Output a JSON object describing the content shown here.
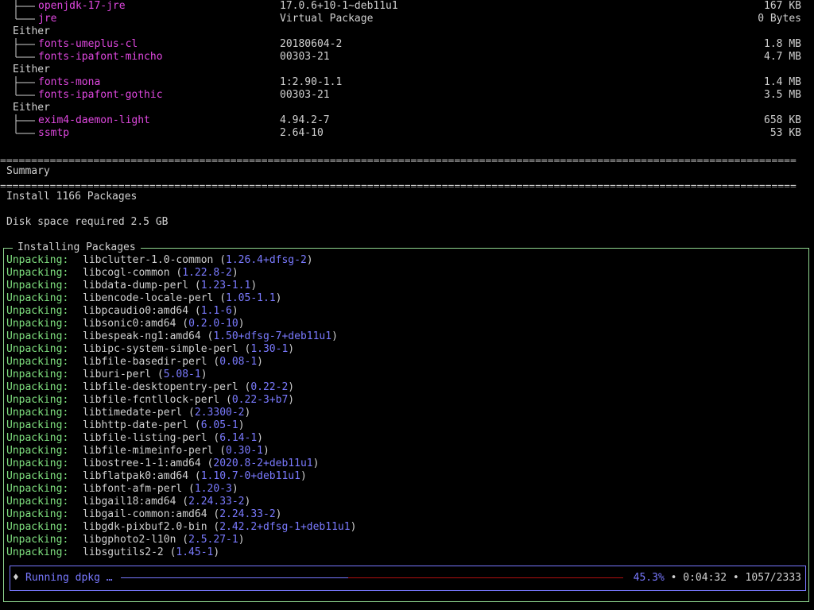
{
  "colors": {
    "background": "#000000",
    "text": "#d0d0d0",
    "package": "#e048e0",
    "status_green": "#7fe07f",
    "version_blue": "#7a7aff",
    "progress_blue": "#7878ff",
    "progress_red": "#b01010",
    "box_border": "#8fd68f"
  },
  "dependencies": {
    "top_items": [
      {
        "name": "openjdk-17-jre",
        "version": "17.0.6+10-1~deb11u1",
        "size": "167 KB"
      },
      {
        "name": "jre",
        "version": "Virtual Package",
        "size": "0 Bytes"
      }
    ],
    "groups": [
      {
        "label": "Either",
        "items": [
          {
            "name": "fonts-umeplus-cl",
            "version": "20180604-2",
            "size": "1.8 MB"
          },
          {
            "name": "fonts-ipafont-mincho",
            "version": "00303-21",
            "size": "4.7 MB"
          }
        ]
      },
      {
        "label": "Either",
        "items": [
          {
            "name": "fonts-mona",
            "version": "1:2.90-1.1",
            "size": "1.4 MB"
          },
          {
            "name": "fonts-ipafont-gothic",
            "version": "00303-21",
            "size": "3.5 MB"
          }
        ]
      },
      {
        "label": "Either",
        "items": [
          {
            "name": "exim4-daemon-light",
            "version": "4.94.2-7",
            "size": "658 KB"
          },
          {
            "name": "ssmtp",
            "version": "2.64-10",
            "size": "53 KB"
          }
        ]
      }
    ]
  },
  "summary": {
    "separator": "================================================================================================================================",
    "title": "Summary",
    "install_count": "Install 1166 Packages",
    "disk_space": "Disk space required  2.5 GB"
  },
  "installing": {
    "title": "Installing Packages",
    "status_label": "Unpacking:",
    "log": [
      {
        "package": "libclutter-1.0-common",
        "version": "1.26.4+dfsg-2"
      },
      {
        "package": "libcogl-common",
        "version": "1.22.8-2"
      },
      {
        "package": "libdata-dump-perl",
        "version": "1.23-1.1"
      },
      {
        "package": "libencode-locale-perl",
        "version": "1.05-1.1"
      },
      {
        "package": "libpcaudio0:amd64",
        "version": "1.1-6"
      },
      {
        "package": "libsonic0:amd64",
        "version": "0.2.0-10"
      },
      {
        "package": "libespeak-ng1:amd64",
        "version": "1.50+dfsg-7+deb11u1"
      },
      {
        "package": "libipc-system-simple-perl",
        "version": "1.30-1"
      },
      {
        "package": "libfile-basedir-perl",
        "version": "0.08-1"
      },
      {
        "package": "liburi-perl",
        "version": "5.08-1"
      },
      {
        "package": "libfile-desktopentry-perl",
        "version": "0.22-2"
      },
      {
        "package": "libfile-fcntllock-perl",
        "version": "0.22-3+b7"
      },
      {
        "package": "libtimedate-perl",
        "version": "2.3300-2"
      },
      {
        "package": "libhttp-date-perl",
        "version": "6.05-1"
      },
      {
        "package": "libfile-listing-perl",
        "version": "6.14-1"
      },
      {
        "package": "libfile-mimeinfo-perl",
        "version": "0.30-1"
      },
      {
        "package": "libostree-1-1:amd64",
        "version": "2020.8-2+deb11u1"
      },
      {
        "package": "libflatpak0:amd64",
        "version": "1.10.7-0+deb11u1"
      },
      {
        "package": "libfont-afm-perl",
        "version": "1.20-3"
      },
      {
        "package": "libgail18:amd64",
        "version": "2.24.33-2"
      },
      {
        "package": "libgail-common:amd64",
        "version": "2.24.33-2"
      },
      {
        "package": "libgdk-pixbuf2.0-bin",
        "version": "2.42.2+dfsg-1+deb11u1"
      },
      {
        "package": "libgphoto2-l10n",
        "version": "2.5.27-1"
      },
      {
        "package": "libsgutils2-2",
        "version": "1.45-1"
      }
    ]
  },
  "progress": {
    "icon": "spinner-icon",
    "icon_glyph": "♦",
    "label": "Running dpkg …",
    "percent": "45.3%",
    "fraction": 0.453,
    "elapsed": "0:04:32",
    "count": "1057/2333",
    "separator": "•"
  }
}
